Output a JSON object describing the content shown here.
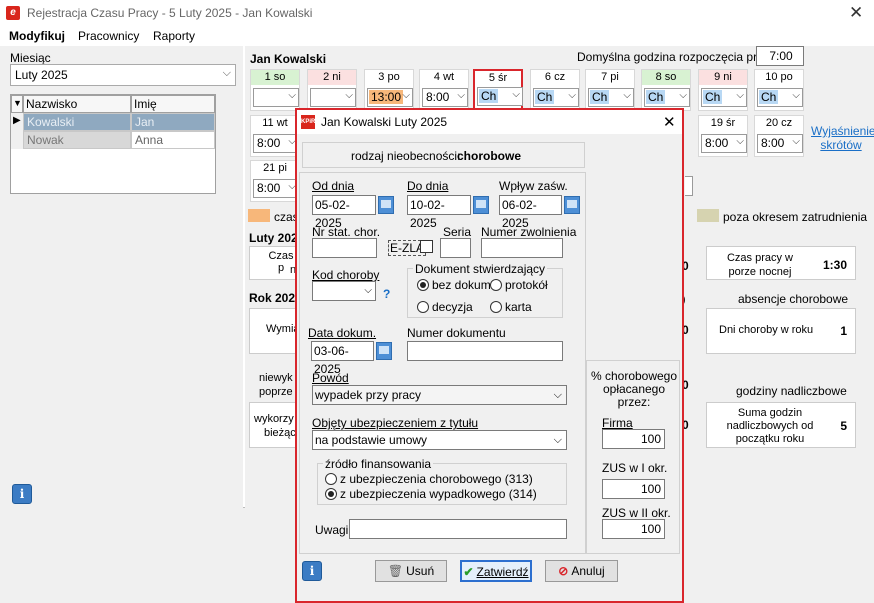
{
  "window": {
    "title": "Rejestracja Czasu Pracy - 5 Luty 2025 - Jan Kowalski",
    "close": "✕"
  },
  "menu": {
    "m1": "Modyfikuj",
    "m2": "Pracownicy",
    "m3": "Raporty"
  },
  "left": {
    "month_label": "Miesiąc",
    "month_value": "Luty 2025",
    "col_surname": "Nazwisko",
    "col_name": "Imię",
    "rows": [
      {
        "surname": "Kowalski",
        "name": "Jan"
      },
      {
        "surname": "Nowak",
        "name": "Anna"
      }
    ]
  },
  "right": {
    "employee": "Jan Kowalski",
    "default_start_label": "Domyślna godzina rozpoczęcia pracy:",
    "default_start_value": "7:00",
    "explain_link": "Wyjaśnienie skrótów",
    "days_row1": [
      {
        "hdr": "1 so",
        "val": ""
      },
      {
        "hdr": "2 ni",
        "val": ""
      },
      {
        "hdr": "3 po",
        "val": "13:00"
      },
      {
        "hdr": "4 wt",
        "val": "8:00"
      },
      {
        "hdr": "5 śr",
        "val": "Ch"
      },
      {
        "hdr": "6 cz",
        "val": "Ch"
      },
      {
        "hdr": "7 pi",
        "val": "Ch"
      },
      {
        "hdr": "8 so",
        "val": "Ch"
      },
      {
        "hdr": "9 ni",
        "val": "Ch"
      },
      {
        "hdr": "10 po",
        "val": "Ch"
      }
    ],
    "days_row2": [
      {
        "hdr": "11 wt",
        "val": "8:00"
      },
      {
        "hdr": "19 śr",
        "val": "8:00"
      },
      {
        "hdr": "20 cz",
        "val": "8:00"
      }
    ],
    "days_row3": [
      {
        "hdr": "21 pi",
        "val": "8:00"
      }
    ],
    "legend_czas": "czas",
    "legend_poza": "poza okresem zatrudnienia",
    "section_month": "Luty 202",
    "section_year": "Rok 202",
    "frag_czas_p": "Czas p",
    "frag_n": "n",
    "frag_wymia": "Wymia",
    "frag_niewyk": "niewyk",
    "frag_poprze": "poprze",
    "frag_wykorzy": "wykorzy",
    "frag_biezac": "bieżąc",
    "frag_zero1": "0",
    "frag_zero2": "0",
    "frag_zero3": "0",
    "frag_zero4": "0",
    "frag_paren": "i)",
    "night_label": "Czas pracy w porze nocnej",
    "night_value": "1:30",
    "absence_hdr": "absencje chorobowe",
    "sick_days_label": "Dni choroby w roku",
    "sick_days_value": "1",
    "overtime_hdr": "godziny nadliczbowe",
    "overtime_label": "Suma godzin nadliczbowych od początku roku",
    "overtime_value": "5"
  },
  "dialog": {
    "title": "Jan Kowalski Luty 2025",
    "absence_type_label": "rodzaj nieobecności:",
    "absence_type_value": "chorobowe",
    "od_dnia_label": "Od dnia",
    "od_dnia_value": "05-02-2025",
    "do_dnia_label": "Do dnia",
    "do_dnia_value": "10-02-2025",
    "wplyw_label": "Wpływ zaśw.",
    "wplyw_value": "06-02-2025",
    "nr_stat_label": "Nr stat. chor.",
    "ezla_label": "E-ZLA",
    "seria_label": "Seria",
    "numer_zw_label": "Numer zwolnienia",
    "kod_choroby_label": "Kod choroby",
    "help_mark": "?",
    "doc_group_label": "Dokument stwierdzający",
    "doc_opt1": "bez dokum.",
    "doc_opt2": "protokół",
    "doc_opt3": "decyzja",
    "doc_opt4": "karta",
    "data_dokum_label": "Data dokum.",
    "data_dokum_value": "03-06-2025",
    "numer_dok_label": "Numer dokumentu",
    "powod_label": "Powód",
    "powod_value": "wypadek przy pracy",
    "objety_label": "Objęty ubezpieczeniem z tytułu",
    "objety_value": "na podstawie umowy",
    "zrodlo_label": "źródło finansowania",
    "zrodlo_opt1": "z ubezpieczenia chorobowego (313)",
    "zrodlo_opt2": "z ubezpieczenia wypadkowego (314)",
    "uwagi_label": "Uwagi",
    "pct_label": "% chorobowego opłacanego przez:",
    "firma_label": "Firma",
    "firma_value": "100",
    "zus1_label": "ZUS w I okr.",
    "zus1_value": "100",
    "zus2_label": "ZUS w II okr.",
    "zus2_value": "100",
    "btn_delete": "Usuń",
    "btn_confirm": "Zatwierdź",
    "btn_cancel": "Anuluj",
    "close": "✕"
  }
}
